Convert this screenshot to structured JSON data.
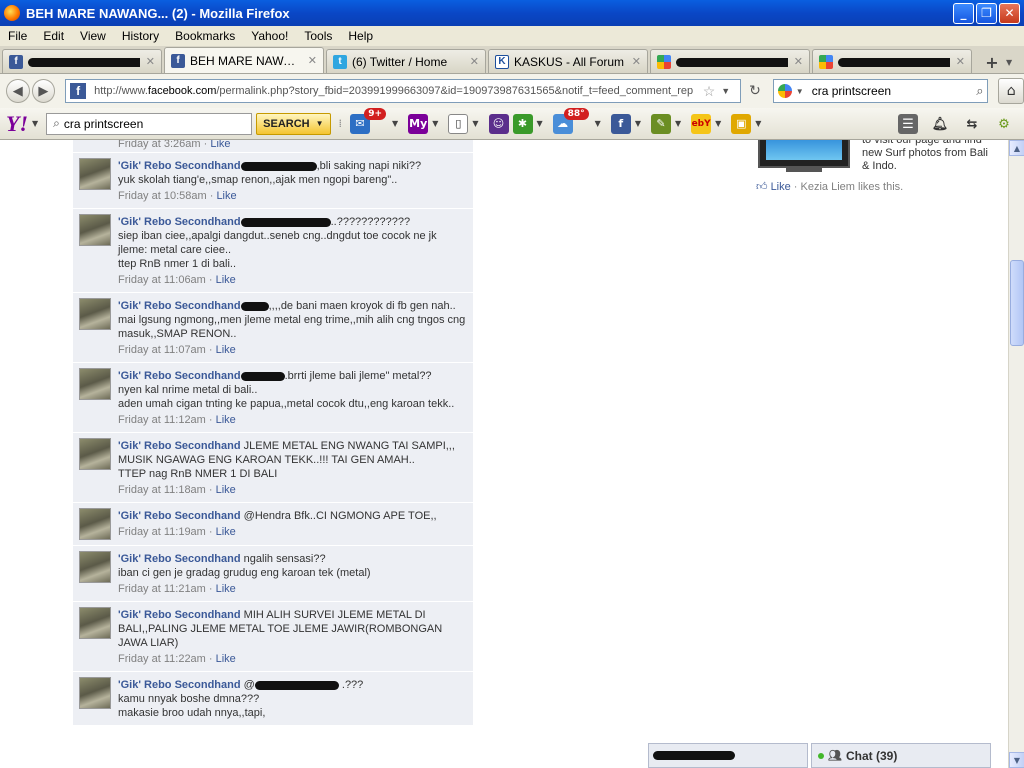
{
  "window": {
    "title": "BEH MARE NAWANG... (2) - Mozilla Firefox",
    "controls": [
      "_",
      "❐",
      "✕"
    ]
  },
  "menu": [
    "File",
    "Edit",
    "View",
    "History",
    "Bookmarks",
    "Yahoo!",
    "Tools",
    "Help"
  ],
  "tabs": [
    {
      "label": "",
      "icon": "facebook-icon",
      "redacted": true,
      "active": false
    },
    {
      "label": "BEH MARE NAWANG....",
      "icon": "facebook-icon",
      "redacted": false,
      "active": true
    },
    {
      "label": "(6) Twitter / Home",
      "icon": "twitter-icon",
      "redacted": false,
      "active": false
    },
    {
      "label": "KASKUS - All Forum",
      "icon": "kaskus-icon",
      "redacted": false,
      "active": false
    },
    {
      "label": "",
      "icon": "google-icon",
      "redacted": true,
      "active": false
    },
    {
      "label": "",
      "icon": "google-icon",
      "redacted": true,
      "active": false
    }
  ],
  "tab_new": "+",
  "nav": {
    "url_prefix": "http://www.",
    "url_domain": "facebook.com",
    "url_rest": "/permalink.php?story_fbid=203991999663097&id=190973987631565&notif_t=feed_comment_rep",
    "search_text": "cra printscreen"
  },
  "yahoo_toolbar": {
    "logo": "Y!",
    "search_text": "cra printscreen",
    "search_button": "SEARCH",
    "mail_badge": "9+",
    "weather_badge": "88°",
    "my_label": "My",
    "ebay_label": "ebY"
  },
  "feed": {
    "top_stub_time": "Friday at 3:26am",
    "top_stub_like": "Like",
    "author": "'Gik' Rebo Secondhand",
    "like_label": "Like",
    "comments": [
      {
        "redact_w": 76,
        "lines": [
          ",bli saking napi niki??",
          "yuk skolah tiang'e,,smap renon,,ajak men ngopi bareng\".."
        ],
        "time": "Friday at 10:58am"
      },
      {
        "redact_w": 90,
        "lines": [
          "..????????????",
          "siep iban ciee,,apalgi dangdut..seneb cng..dngdut toe cocok ne jk jleme: metal care ciee..",
          "ttep RnB nmer 1 di bali.."
        ],
        "time": "Friday at 11:06am"
      },
      {
        "redact_w": 28,
        "lines": [
          ",,,,de bani maen kroyok di fb gen nah..",
          "mai lgsung ngmong,,men jleme metal eng trime,,mih alih cng tngos cng masuk,,SMAP RENON.."
        ],
        "time": "Friday at 11:07am"
      },
      {
        "redact_w": 44,
        "lines": [
          ".brrti jleme bali jleme\" metal??",
          "nyen kal nrime metal di bali..",
          "aden umah cigan tnting ke papua,,metal cocok dtu,,eng karoan tekk.."
        ],
        "time": "Friday at 11:12am"
      },
      {
        "redact_w": 0,
        "lines": [
          " JLEME METAL ENG NWANG TAI SAMPI,,, MUSIK NGAWAG ENG KAROAN TEKK..!!! TAI GEN AMAH..",
          "TTEP nag RnB NMER 1 DI BALI"
        ],
        "time": "Friday at 11:18am"
      },
      {
        "redact_w": 0,
        "lines": [
          " @Hendra Bfk..CI NGMONG APE TOE,,"
        ],
        "time": "Friday at 11:19am"
      },
      {
        "redact_w": 0,
        "lines": [
          " ngalih sensasi??",
          "iban ci gen je gradag grudug eng karoan tek (metal)"
        ],
        "time": "Friday at 11:21am"
      },
      {
        "redact_w": 0,
        "lines": [
          " MIH ALIH SURVEI JLEME METAL DI BALI,,PALING JLEME METAL TOE JLEME JAWIR(ROMBONGAN JAWA LIAR)"
        ],
        "time": "Friday at 11:22am"
      },
      {
        "redact_w": 84,
        "prefix": " @",
        "lines": [
          " .???",
          "kamu nnyak boshe dmna???",
          "makasie broo udah nnya,,tapi,"
        ],
        "time": ""
      }
    ]
  },
  "ad": {
    "text": "to visit our page and find new Surf photos from Bali & Indo.",
    "like_label": "Like",
    "likes_text": " · Kezia Liem likes this."
  },
  "chat": {
    "label": "Chat (39)"
  }
}
